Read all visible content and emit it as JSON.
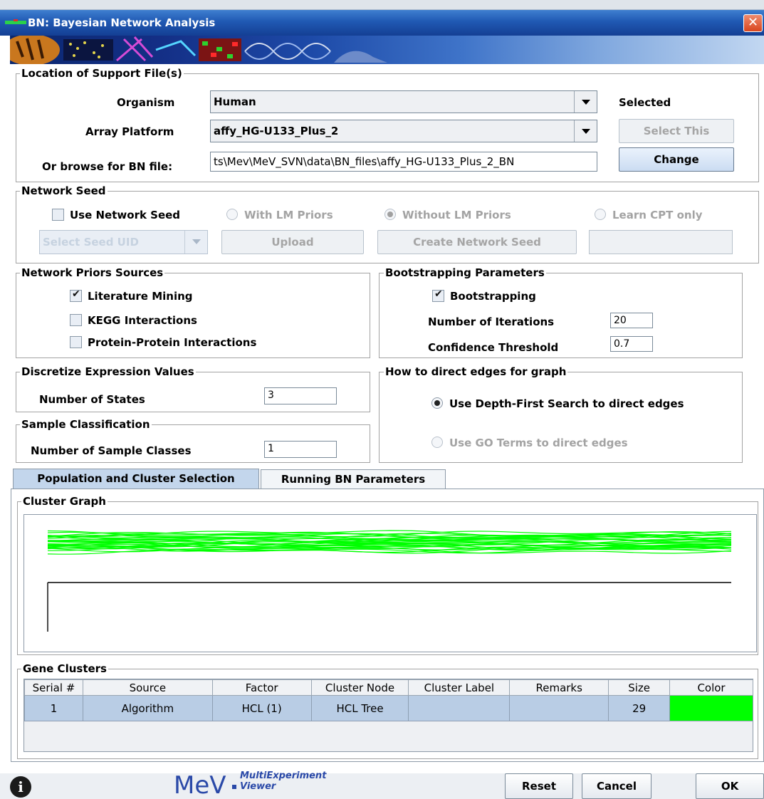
{
  "window": {
    "title": "BN: Bayesian Network Analysis",
    "close_glyph": "✕"
  },
  "support": {
    "title": "Location of Support File(s)",
    "organism_label": "Organism",
    "organism_value": "Human",
    "platform_label": "Array Platform",
    "platform_value": "affy_HG-U133_Plus_2",
    "browse_label": "Or browse for BN file:",
    "browse_value": "ts\\Mev\\MeV_SVN\\data\\BN_files\\affy_HG-U133_Plus_2_BN",
    "selected_label": "Selected",
    "select_this": "Select This",
    "change": "Change"
  },
  "seed": {
    "title": "Network Seed",
    "use_seed_label": "Use Network Seed",
    "use_seed_checked": false,
    "with_lm": "With LM Priors",
    "without_lm": "Without LM Priors",
    "learn_cpt": "Learn CPT only",
    "seed_uid_placeholder": "Select Seed UID",
    "upload": "Upload",
    "create": "Create Network Seed"
  },
  "priors": {
    "title": "Network Priors Sources",
    "items": [
      {
        "label": "Literature Mining",
        "checked": true
      },
      {
        "label": "KEGG Interactions",
        "checked": false
      },
      {
        "label": "Protein-Protein Interactions",
        "checked": false
      }
    ]
  },
  "bootstrap": {
    "title": "Bootstrapping Parameters",
    "label": "Bootstrapping",
    "checked": true,
    "iterations_label": "Number of Iterations",
    "iterations_value": "20",
    "threshold_label": "Confidence Threshold",
    "threshold_value": "0.7"
  },
  "discretize": {
    "title": "Discretize Expression Values",
    "states_label": "Number of States",
    "states_value": "3"
  },
  "sample": {
    "title": "Sample Classification",
    "classes_label": "Number of Sample Classes",
    "classes_value": "1"
  },
  "edges": {
    "title": "How to direct edges for graph",
    "dfs": "Use Depth-First Search to direct edges",
    "go": "Use GO Terms to direct edges"
  },
  "tabs": [
    {
      "label": "Population and Cluster Selection",
      "active": true
    },
    {
      "label": "Running BN Parameters",
      "active": false
    }
  ],
  "cluster_graph": {
    "title": "Cluster Graph",
    "line_color": "#00ff00"
  },
  "gene_clusters": {
    "title": "Gene Clusters",
    "columns": [
      "Serial #",
      "Source",
      "Factor",
      "Cluster Node",
      "Cluster Label",
      "Remarks",
      "Size",
      "Color"
    ],
    "rows": [
      {
        "serial": "1",
        "source": "Algorithm",
        "factor": "HCL (1)",
        "node": "HCL Tree",
        "label": "",
        "remarks": "",
        "size": "29",
        "color": "#00ff00"
      }
    ]
  },
  "footer": {
    "info_glyph": "i",
    "logo": "MeV",
    "logo_sub1": "MultiExperiment",
    "logo_sub2": "Viewer",
    "reset": "Reset",
    "cancel": "Cancel",
    "ok": "OK"
  }
}
